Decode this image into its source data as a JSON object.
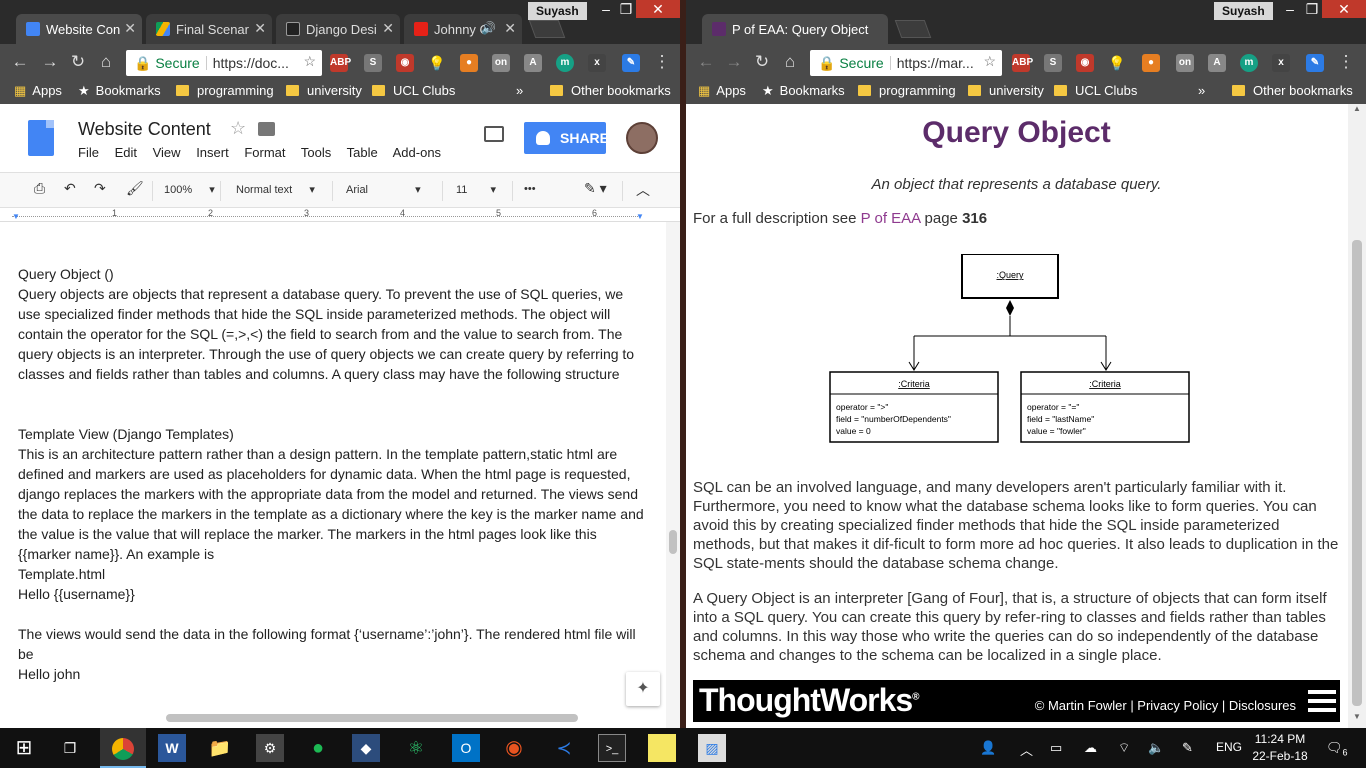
{
  "left_window": {
    "tabs": [
      {
        "label": "Website Con",
        "icon": "docs-icon"
      },
      {
        "label": "Final Scenar",
        "icon": "drive-icon"
      },
      {
        "label": "Django Desi",
        "icon": "person-icon"
      },
      {
        "label": "Johnny C",
        "icon": "youtube-icon"
      }
    ],
    "user": "Suyash",
    "omnibox": {
      "secure": "Secure",
      "url": "https://doc..."
    },
    "extensions": {
      "abp": "ABP",
      "abp_count": "1"
    },
    "bookmarks": [
      "Apps",
      "Bookmarks",
      "programming",
      "university",
      "UCL Clubs"
    ],
    "other_bookmarks": "Other bookmarks",
    "overflow": "»",
    "docs": {
      "title": "Website Content",
      "menu": [
        "File",
        "Edit",
        "View",
        "Insert",
        "Format",
        "Tools",
        "Table",
        "Add-ons"
      ],
      "share": "SHARE",
      "zoom": "100%",
      "style": "Normal text",
      "font": "Arial",
      "size": "11",
      "more": "•••",
      "ruler": [
        "1",
        "2",
        "3",
        "4",
        "5",
        "6"
      ],
      "paragraphs": [
        "Query Object ()",
        "Query objects are objects that represent a database query. To prevent the use of SQL queries, we use specialized finder methods that hide the SQL inside parameterized methods. The object will contain the operator for the SQL (=,>,<) the field to search from and the value to search from. The query objects is an interpreter. Through the use of query objects we can create query by referring to classes and fields rather than tables and columns.  A query class may have the following structure",
        "Template View (Django Templates)",
        "This is an architecture pattern rather than a design pattern. In the template pattern,static html are defined and markers are used as placeholders for dynamic data. When the html page is requested, django replaces the markers with the appropriate data from the model and returned. The views send the data to replace the markers in the template as a dictionary where the key is the marker name and the value is the value that will replace the marker. The markers in the html pages look like this {{marker name}}. An example is",
        "Template.html",
        "Hello {{username}}",
        "The views would send the data in the following format {‘username’:’john’}. The rendered html file will be",
        "Hello john"
      ]
    }
  },
  "right_window": {
    "tab": {
      "label": "P of EAA: Query Object",
      "icon": "fowler-icon"
    },
    "user": "Suyash",
    "omnibox": {
      "secure": "Secure",
      "url": "https://mar..."
    },
    "extensions": {
      "abp": "ABP"
    },
    "bookmarks": [
      "Apps",
      "Bookmarks",
      "programming",
      "university",
      "UCL Clubs"
    ],
    "other_bookmarks": "Other bookmarks",
    "overflow": "»",
    "page": {
      "title": "Query Object",
      "intent": "An object that represents a database query.",
      "desc_prefix": "For a full description see ",
      "desc_link": "P of EAA",
      "desc_mid": " page ",
      "desc_page": "316",
      "uml": {
        "root": ":Query",
        "left_box": {
          "title": ":Criteria",
          "lines": [
            "operator = \">\"",
            "field = \"numberOfDependents\"",
            "value = 0"
          ]
        },
        "right_box": {
          "title": ":Criteria",
          "lines": [
            "operator = \"=\"",
            "field = \"lastName\"",
            "value = \"fowler\""
          ]
        }
      },
      "para1": "SQL can be an involved language, and many developers aren't particularly familiar with it. Furthermore, you need to know what the database schema looks like to form queries. You can avoid this by creating specialized finder methods that hide the SQL inside parameterized methods, but that makes it dif-ficult to form more ad hoc queries. It also leads to duplication in the SQL state-ments should the database schema change.",
      "para2": "A Query Object is an interpreter [Gang of Four], that is, a structure of objects that can form itself into a SQL query. You can create this query by refer-ring to classes and fields rather than tables and columns. In this way those who write the queries can do so independently of the database schema and changes to the schema can be localized in a single place.",
      "footer_logo": "ThoughtWorks",
      "footer_reg": "®",
      "footer_links": "© Martin Fowler | Privacy Policy | Disclosures"
    }
  },
  "taskbar": {
    "language": "ENG",
    "time": "11:24 PM",
    "date": "22-Feb-18",
    "notifications": "6"
  }
}
